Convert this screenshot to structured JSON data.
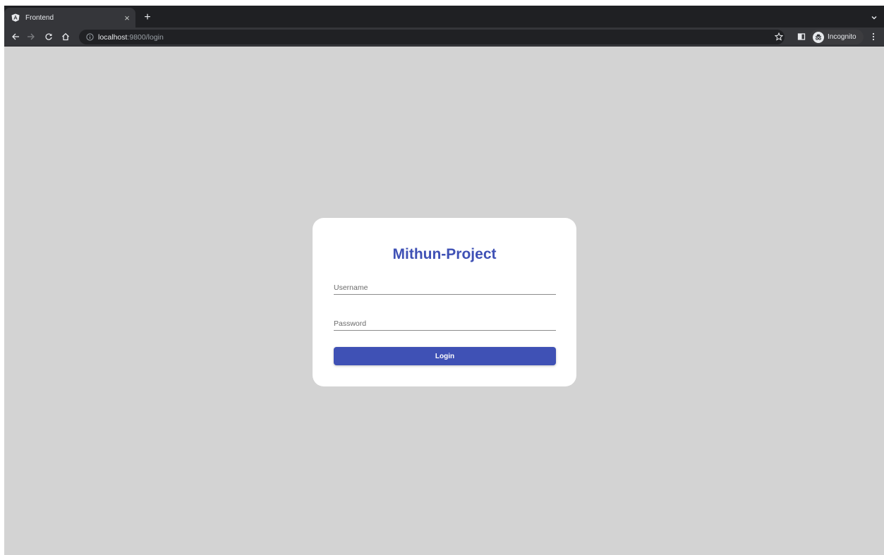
{
  "browser": {
    "tab": {
      "title": "Frontend",
      "favicon": "angular-icon",
      "close": "×"
    },
    "new_tab": "+",
    "address": {
      "host": "localhost",
      "rest": ":9800/login"
    },
    "incognito_label": "Incognito"
  },
  "login": {
    "title": "Mithun-Project",
    "username_placeholder": "Username",
    "password_placeholder": "Password",
    "button_label": "Login"
  },
  "colors": {
    "primary": "#3f51b5",
    "page_background": "#d3d3d3",
    "browser_dark": "#1f2023"
  }
}
